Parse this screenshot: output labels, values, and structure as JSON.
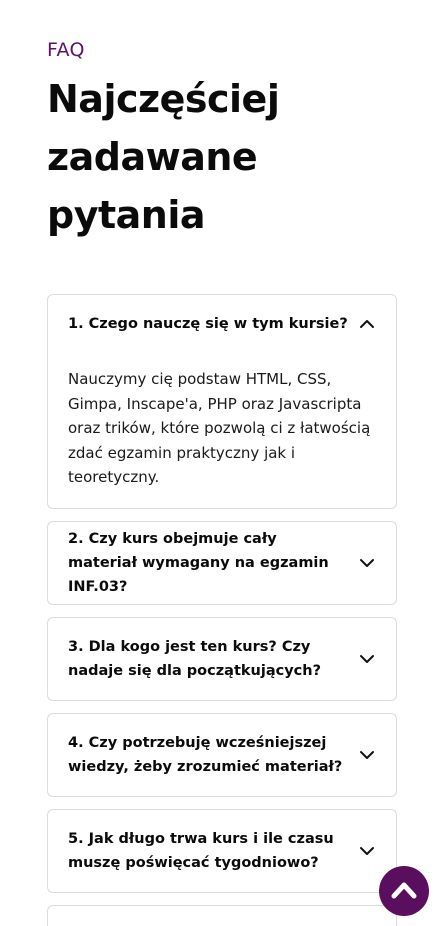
{
  "section": {
    "eyebrow": "FAQ",
    "heading": "Najczęściej zadawane pytania"
  },
  "faq": [
    {
      "question": "1. Czego nauczę się w tym kursie?",
      "answer": "Nauczymy cię podstaw HTML, CSS, Gimpa, Inscape'a, PHP oraz Javascripta oraz trików, które pozwolą ci z łatwością zdać egzamin praktyczny jak i teoretyczny.",
      "expanded": true,
      "icon": "chevron-up-icon"
    },
    {
      "question": "2. Czy kurs obejmuje cały materiał wymagany na egzamin INF.03?",
      "expanded": false,
      "icon": "chevron-down-icon"
    },
    {
      "question": "3. Dla kogo jest ten kurs? Czy nadaje się dla początkujących?",
      "expanded": false,
      "icon": "chevron-down-icon"
    },
    {
      "question": "4. Czy potrzebuję wcześniejszej wiedzy, żeby zrozumieć materiał?",
      "expanded": false,
      "icon": "chevron-down-icon"
    },
    {
      "question": "5. Jak długo trwa kurs i ile czasu muszę poświęcać tygodniowo?",
      "expanded": false,
      "icon": "chevron-down-icon"
    }
  ],
  "scroll_top": {
    "icon": "chevron-up-icon",
    "color": "#5a0f5e"
  },
  "colors": {
    "accent": "#5a1566",
    "border": "#dcdcdc",
    "text": "#0b0b0b"
  }
}
